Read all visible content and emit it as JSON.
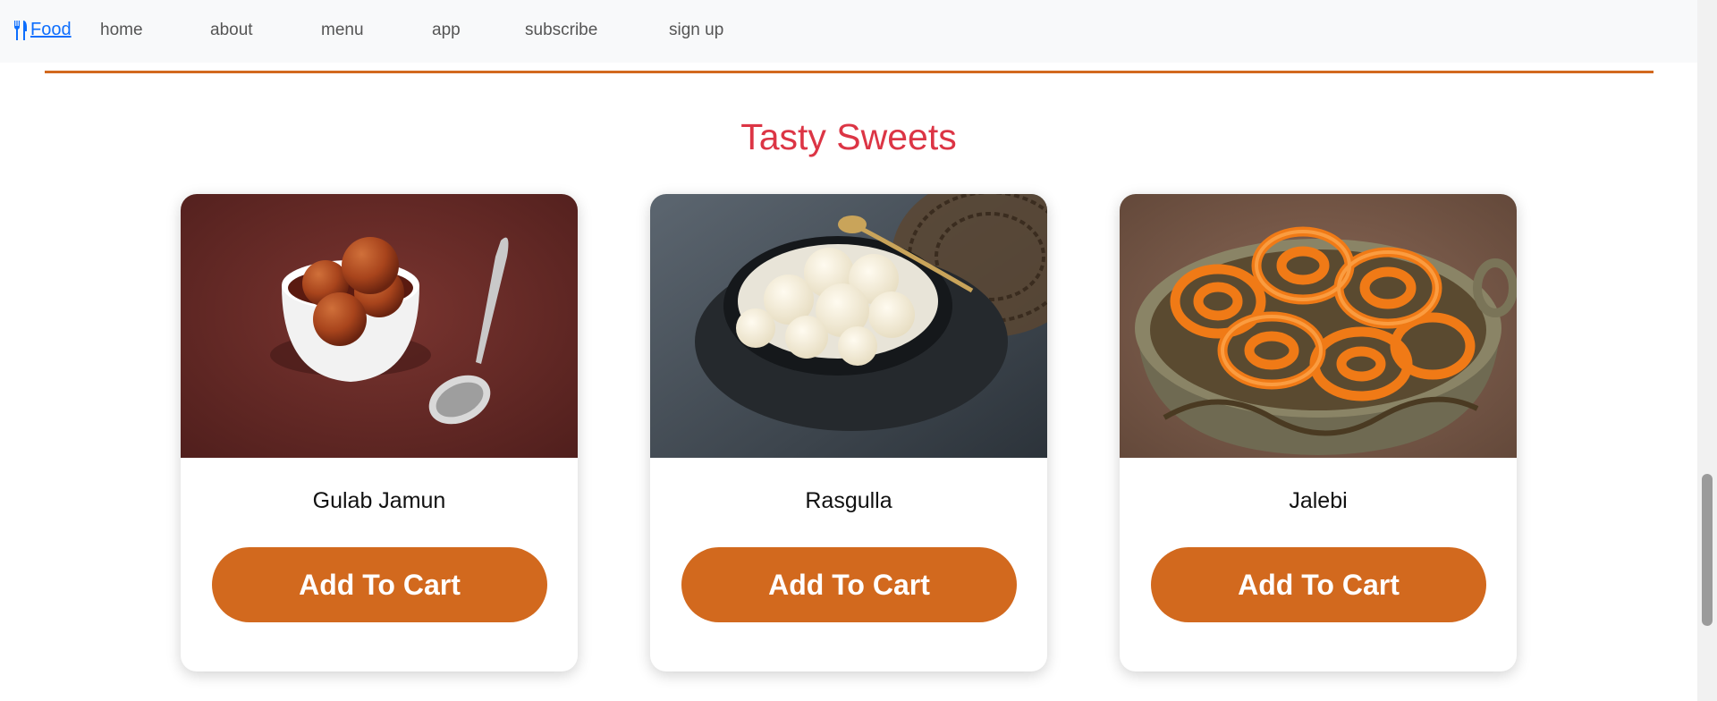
{
  "navbar": {
    "brand": "Food",
    "brand_icon": "fork-knife-icon",
    "links": [
      "home",
      "about",
      "menu",
      "app",
      "subscribe",
      "sign up"
    ]
  },
  "section": {
    "title": "Tasty Sweets"
  },
  "products": [
    {
      "name": "Gulab Jamun",
      "button": "Add To Cart"
    },
    {
      "name": "Rasgulla",
      "button": "Add To Cart"
    },
    {
      "name": "Jalebi",
      "button": "Add To Cart"
    }
  ],
  "colors": {
    "accent": "#d2691e",
    "title": "#dc3545",
    "brand": "#0d6efd",
    "navbar_bg": "#f8f9fa"
  }
}
